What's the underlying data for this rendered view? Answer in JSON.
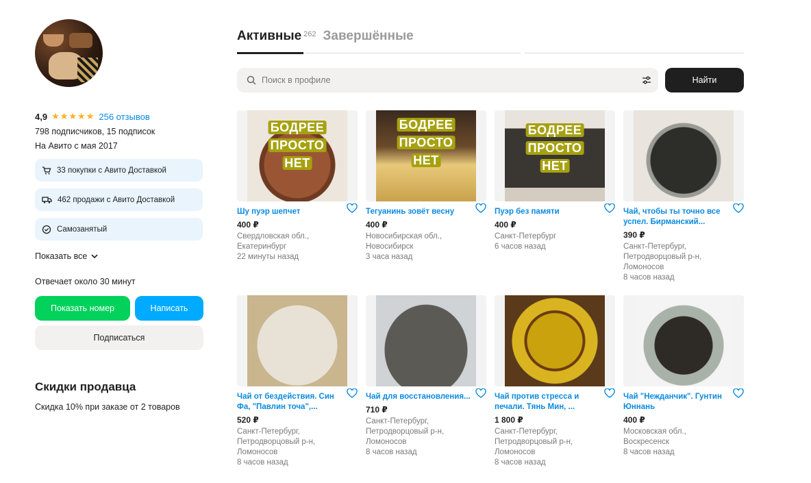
{
  "profile": {
    "rating": "4,9",
    "stars": "★★★★★",
    "reviews": "256 отзывов",
    "followers": "798 подписчиков, 15 подписок",
    "since": "На Авито с мая 2017",
    "badges": [
      {
        "icon": "cart-icon",
        "text": "33 покупки с Авито Доставкой"
      },
      {
        "icon": "truck-icon",
        "text": "462 продажи с Авито Доставкой"
      },
      {
        "icon": "check-circle-icon",
        "text": "Самозанятый"
      }
    ],
    "show_all": "Показать все",
    "responds": "Отвечает около 30 минут",
    "phone_button": "Показать номер",
    "write_button": "Написать",
    "subscribe_button": "Подписаться",
    "discount_title": "Скидки продавца",
    "discount_text": "Скидка 10% при заказе от 2 товаров"
  },
  "tabs": {
    "active_label": "Активные",
    "active_count": "262",
    "finished_label": "Завершённые"
  },
  "search": {
    "placeholder": "Поиск в профиле",
    "button": "Найти"
  },
  "promo_text": [
    "БОДРЕЕ",
    "ПРОСТО",
    "НЕТ"
  ],
  "listings": [
    {
      "title": "Шу пуэр шепчет",
      "price": "400 ₽",
      "loc1": "Свердловская обл.,",
      "loc2": "Екатеринбург",
      "loc3": "",
      "time": "22 минуты назад"
    },
    {
      "title": "Тегуанинь зовёт весну",
      "price": "400 ₽",
      "loc1": "Новосибирская обл.,",
      "loc2": "Новосибирск",
      "loc3": "",
      "time": "3 часа назад"
    },
    {
      "title": "Пуэр без памяти",
      "price": "400 ₽",
      "loc1": "Санкт-Петербург",
      "loc2": "",
      "loc3": "",
      "time": "6 часов назад"
    },
    {
      "title": "Чай, чтобы ты точно все успел. Бирманский...",
      "price": "390 ₽",
      "loc1": "Санкт-Петербург,",
      "loc2": "Петродворцовый р-н,",
      "loc3": "Ломоносов",
      "time": "8 часов назад"
    },
    {
      "title": "Чай от бездействия. Син Фа, \"Павлин точа\",...",
      "price": "520 ₽",
      "loc1": "Санкт-Петербург,",
      "loc2": "Петродворцовый р-н,",
      "loc3": "Ломоносов",
      "time": "8 часов назад"
    },
    {
      "title": "Чай для восстановления...",
      "price": "710 ₽",
      "loc1": "Санкт-Петербург,",
      "loc2": "Петродворцовый р-н,",
      "loc3": "Ломоносов",
      "time": "8 часов назад"
    },
    {
      "title": "Чай против стресса и печали. Тянь Мин, ...",
      "price": "1 800 ₽",
      "loc1": "Санкт-Петербург,",
      "loc2": "Петродворцовый р-н,",
      "loc3": "Ломоносов",
      "time": "8 часов назад"
    },
    {
      "title": "Чай \"Нежданчик\". Гунтин Юннань",
      "price": "400 ₽",
      "loc1": "Московская обл.,",
      "loc2": "Воскресенск",
      "loc3": "",
      "time": "8 часов назад"
    }
  ],
  "colors": {
    "accent_blue": "#0a8ae0",
    "green": "#02d15c",
    "blue_button": "#00aaff",
    "dark": "#1f1f1f"
  }
}
